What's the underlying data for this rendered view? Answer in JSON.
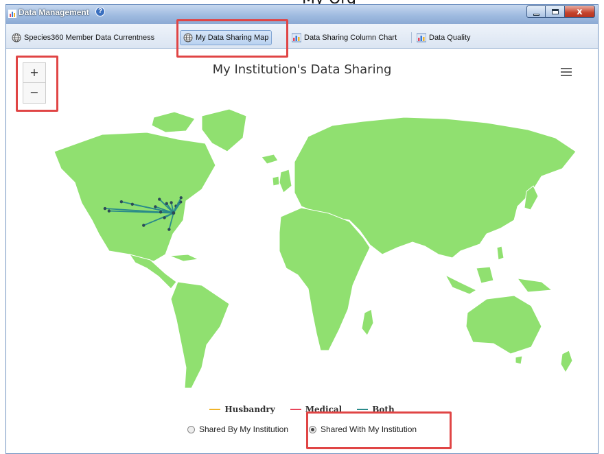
{
  "window": {
    "title": "Data Management",
    "close_glyph": "x"
  },
  "tabs": [
    {
      "label": "Species360 Member Data Currentness",
      "icon": "globe-icon"
    },
    {
      "label": "My Data Sharing Map",
      "icon": "globe-icon",
      "active": true
    },
    {
      "label": "Data Sharing Column Chart",
      "icon": "bar-chart-icon"
    },
    {
      "label": "Data Quality",
      "icon": "bar-chart-icon"
    }
  ],
  "map": {
    "title": "My Institution's Data Sharing",
    "zoom_in_label": "+",
    "zoom_out_label": "−",
    "land_color": "#90e070",
    "route_color": "#2a8a8a",
    "origin": [
      -78.6,
      35.8
    ],
    "connections": [
      [
        -122.4,
        37.8
      ],
      [
        -119.8,
        36.7
      ],
      [
        -111.9,
        40.8
      ],
      [
        -104.9,
        39.7
      ],
      [
        -97.7,
        30.3
      ],
      [
        -90.2,
        38.6
      ],
      [
        -87.6,
        41.9
      ],
      [
        -84.4,
        33.7
      ],
      [
        -86.8,
        36.2
      ],
      [
        -83.0,
        40.0
      ],
      [
        -80.0,
        40.4
      ],
      [
        -77.0,
        38.9
      ],
      [
        -75.2,
        40.0
      ],
      [
        -74.0,
        40.7
      ],
      [
        -81.4,
        28.5
      ],
      [
        -73.8,
        42.6
      ]
    ]
  },
  "legend": [
    {
      "label": "Husbandry",
      "color": "#f0b429"
    },
    {
      "label": "Medical",
      "color": "#e8455a"
    },
    {
      "label": "Both",
      "color": "#2a8a8a"
    }
  ],
  "radios": [
    {
      "label": "Shared By My Institution",
      "selected": false
    },
    {
      "label": "Shared With My Institution",
      "selected": true
    }
  ]
}
